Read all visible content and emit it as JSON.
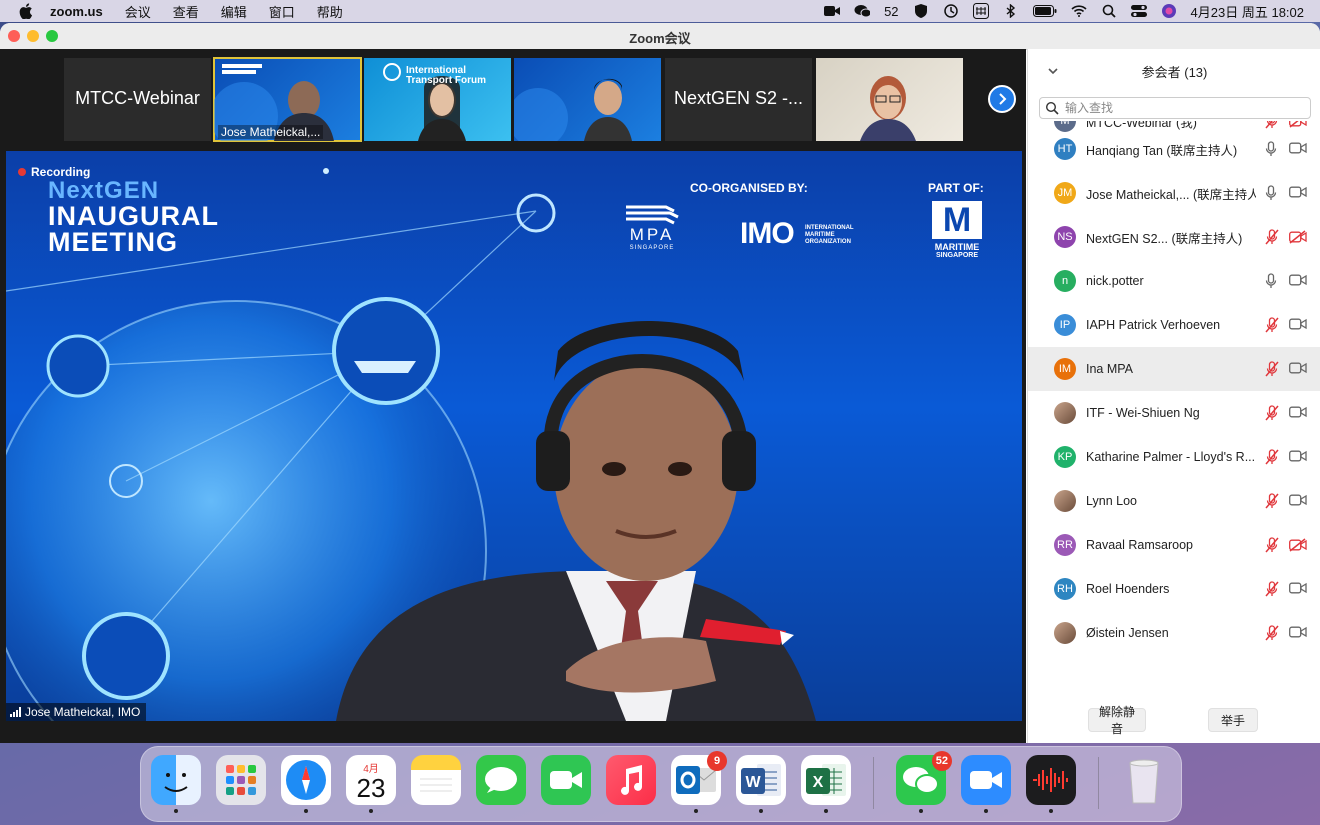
{
  "menubar": {
    "app": "zoom.us",
    "items": [
      "会议",
      "查看",
      "编辑",
      "窗口",
      "帮助"
    ],
    "wechat_count": "52",
    "datetime": "4月23日 周五  18:02"
  },
  "window": {
    "title": "Zoom会议"
  },
  "gallery": {
    "tiles": [
      {
        "label": "MTCC-Webinar"
      },
      {
        "label": "Jose Matheickal,..."
      },
      {
        "label": "International Transport Forum"
      },
      {
        "label": ""
      },
      {
        "label": "NextGEN S2 -..."
      },
      {
        "label": ""
      }
    ]
  },
  "main_video": {
    "recording_label": "Recording",
    "headline_1": "NextGEN",
    "headline_2": "INAUGURAL MEETING",
    "co_organised": "CO-ORGANISED BY:",
    "part_of": "PART OF:",
    "mpa": "MPA",
    "mpa_sub": "SINGAPORE",
    "imo": "IMO",
    "imo_sub": "INTERNATIONAL MARITIME ORGANIZATION",
    "maritime": "MARITIME",
    "maritime_sub": "SINGAPORE",
    "speaker": "Jose Matheickal, IMO"
  },
  "participants": {
    "title": "参会者 (13)",
    "search_placeholder": "输入查找",
    "list": [
      {
        "initials": "M",
        "name": "MTCC-Webinar (我)",
        "color": "#5b6b8a",
        "mic": "muted",
        "cam": "off"
      },
      {
        "initials": "HT",
        "name": "Hanqiang Tan (联席主持人)",
        "color": "#2f7fc1",
        "mic": "on",
        "cam": "on"
      },
      {
        "initials": "JM",
        "name": "Jose Matheickal,... (联席主持人)",
        "color": "#f0a818",
        "mic": "on",
        "cam": "on"
      },
      {
        "initials": "NS",
        "name": "NextGEN S2... (联席主持人)",
        "color": "#8e44ad",
        "mic": "muted",
        "cam": "off"
      },
      {
        "initials": "n",
        "name": "nick.potter",
        "color": "#27ae60",
        "mic": "on",
        "cam": "on"
      },
      {
        "initials": "IP",
        "name": "IAPH Patrick Verhoeven",
        "color": "#3a8dd8",
        "mic": "muted",
        "cam": "on"
      },
      {
        "initials": "IM",
        "name": "Ina MPA",
        "color": "#e8710a",
        "mic": "muted",
        "cam": "on"
      },
      {
        "initials": "",
        "name": "ITF - Wei-Shiuen Ng",
        "color": "photo",
        "mic": "muted",
        "cam": "on"
      },
      {
        "initials": "KP",
        "name": "Katharine Palmer - Lloyd's R...",
        "color": "#20b26b",
        "mic": "muted",
        "cam": "on"
      },
      {
        "initials": "",
        "name": "Lynn Loo",
        "color": "photo",
        "mic": "muted",
        "cam": "on"
      },
      {
        "initials": "RR",
        "name": "Ravaal Ramsaroop",
        "color": "#9b59b6",
        "mic": "muted",
        "cam": "off"
      },
      {
        "initials": "RH",
        "name": "Roel Hoenders",
        "color": "#2e86c1",
        "mic": "muted",
        "cam": "on"
      },
      {
        "initials": "",
        "name": "Øistein Jensen",
        "color": "photo",
        "mic": "muted",
        "cam": "on"
      }
    ],
    "unmute_label": "解除静音",
    "raise_hand_label": "举手"
  },
  "dock": {
    "calendar_month": "4月",
    "calendar_day": "23",
    "outlook_badge": "9",
    "wechat_badge": "52"
  }
}
